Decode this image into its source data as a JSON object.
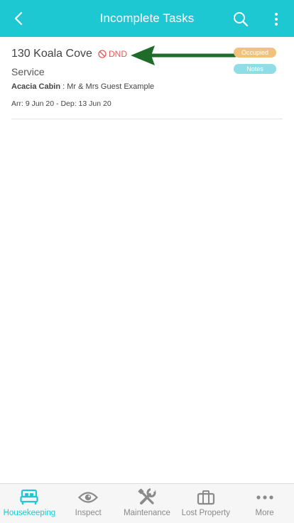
{
  "header": {
    "title": "Incomplete Tasks"
  },
  "task": {
    "room": "130 Koala Cove",
    "dnd_label": "DND",
    "type": "Service",
    "location": "Acacia Cabin",
    "guest_separator": " : ",
    "guest": "Mr & Mrs Guest Example",
    "dates": "Arr: 9 Jun 20 - Dep: 13 Jun 20",
    "status_badge": "Occupied",
    "notes_badge": "Notes"
  },
  "bottom_nav": {
    "items": [
      {
        "label": "Housekeeping",
        "icon": "bed-icon",
        "active": true
      },
      {
        "label": "Inspect",
        "icon": "eye-icon",
        "active": false
      },
      {
        "label": "Maintenance",
        "icon": "tools-icon",
        "active": false
      },
      {
        "label": "Lost Property",
        "icon": "briefcase-icon",
        "active": false
      },
      {
        "label": "More",
        "icon": "more-dots-icon",
        "active": false
      }
    ]
  },
  "colors": {
    "primary": "#1ec8d3",
    "dnd": "#e15b5b",
    "occupied_badge": "#f0c27b",
    "notes_badge": "#8fdde6",
    "annotation_arrow": "#1e6b2a",
    "nav_inactive": "#8a8a8a"
  }
}
